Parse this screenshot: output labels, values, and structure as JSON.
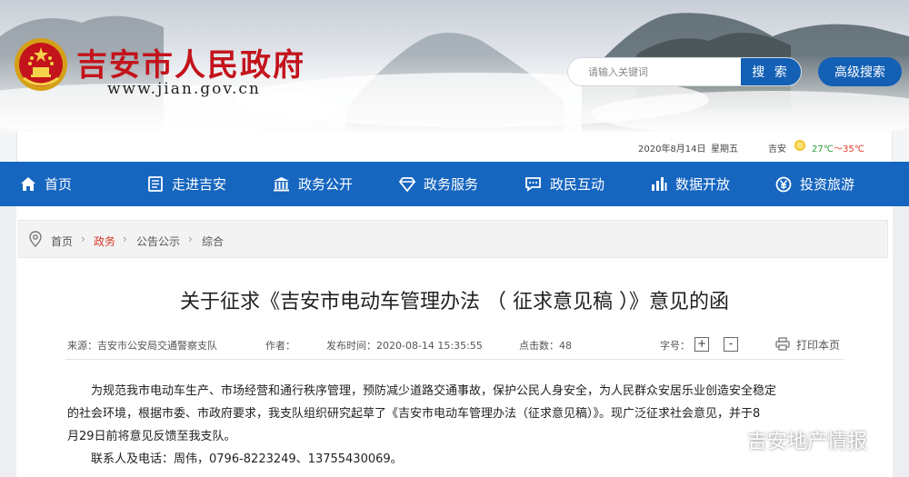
{
  "header": {
    "site_title": "吉安市人民政府",
    "site_url": "www.jian.gov.cn",
    "search_placeholder": "请输入关键词",
    "search_label": "搜 索",
    "advanced_search_label": "高级搜索"
  },
  "infobar": {
    "date": "2020年8月14日",
    "weekday": "星期五",
    "city": "吉安",
    "temp_low": "27℃",
    "temp_sep": "～",
    "temp_high": "35℃"
  },
  "nav": {
    "items": [
      {
        "label": "首页",
        "icon": "home-icon"
      },
      {
        "label": "走进吉安",
        "icon": "book-icon"
      },
      {
        "label": "政务公开",
        "icon": "building-icon"
      },
      {
        "label": "政务服务",
        "icon": "diamond-icon"
      },
      {
        "label": "政民互动",
        "icon": "chat-icon"
      },
      {
        "label": "数据开放",
        "icon": "bars-icon"
      },
      {
        "label": "投资旅游",
        "icon": "yen-icon"
      }
    ]
  },
  "breadcrumb": [
    "首页",
    "政务",
    "公告公示",
    "综合"
  ],
  "article": {
    "title": "关于征求《吉安市电动车管理办法 （ 征求意见稿 ）》意见的函",
    "source": "来源：吉安市公安局交通警察支队",
    "author": "作者：",
    "published": "发布时间：2020-08-14 15:35:55",
    "clicks": "点击数：48",
    "font_size_label": "字号：",
    "zoom_in": "+",
    "zoom_out": "-",
    "print_label": "打印本页",
    "paragraph1_line1": "为规范我市电动车生产、市场经营和通行秩序管理，预防减少道路交通事故，保护公民人身安全，为人民群众安居乐业创造安全稳定",
    "paragraph1_line2": "的社会环境，根据市委、市政府要求，我支队组织研究起草了《吉安市电动车管理办法（征求意见稿）》。现广泛征求社会意见，并于8",
    "paragraph1_line3": "月29日前将意见反馈至我支队。",
    "paragraph2": "联系人及电话：周伟，0796-8223249、13755430069。"
  },
  "watermark": "吉安地产情报",
  "colors": {
    "brand_red": "#c3131b",
    "nav_blue": "#1666c0",
    "button_blue": "#1360b5",
    "breadcrumb_active": "#d83a2a"
  }
}
